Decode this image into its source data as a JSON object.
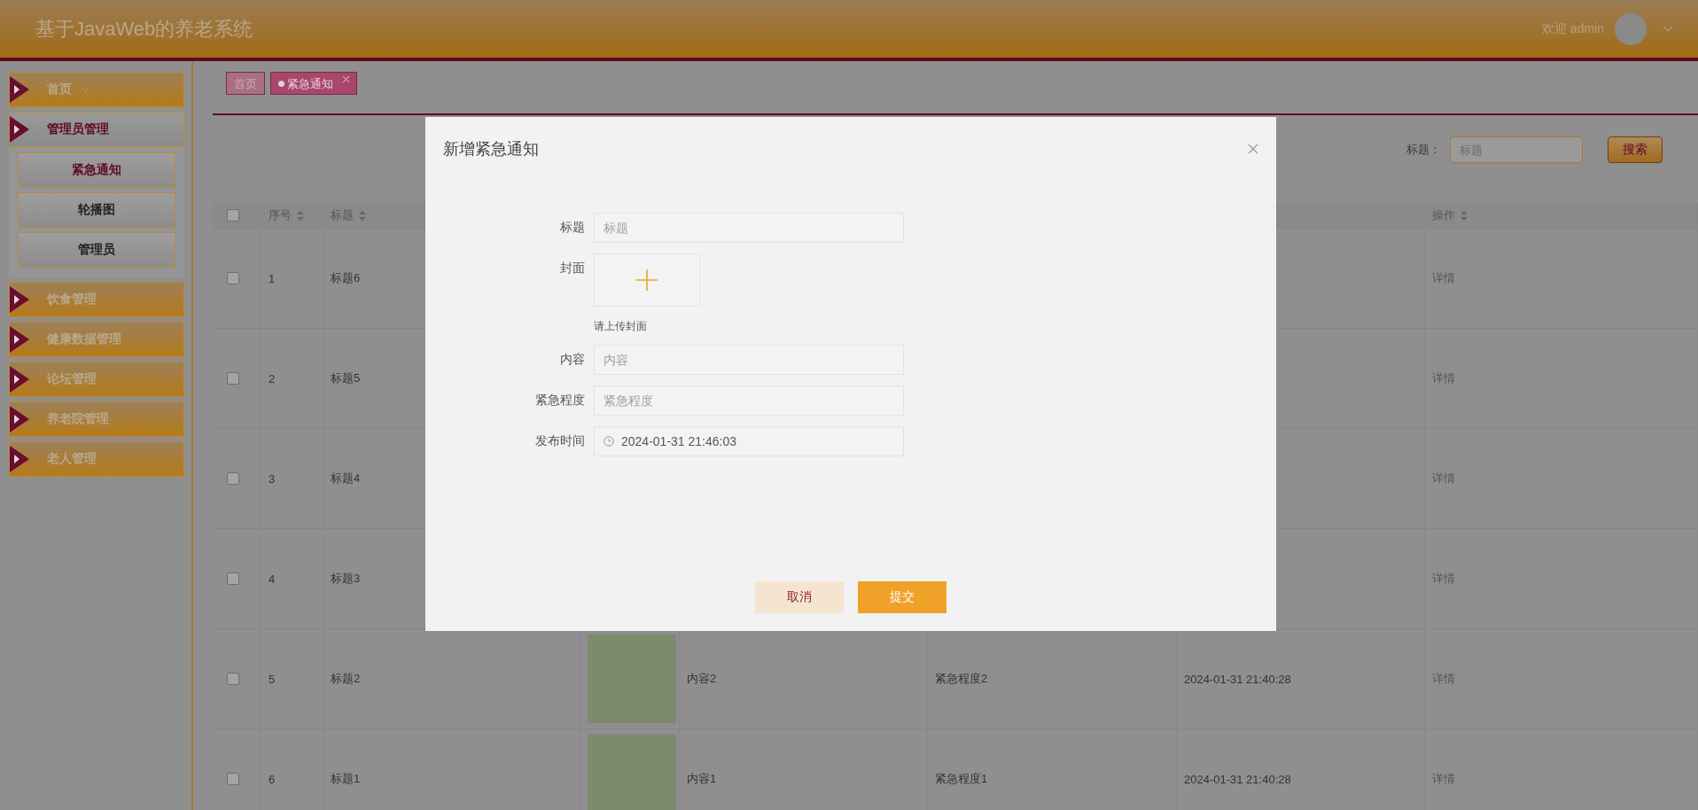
{
  "header": {
    "title": "基于JavaWeb的养老系统",
    "welcome": "欢迎 admin"
  },
  "sidebar": {
    "items": [
      {
        "label": "首页",
        "chevron": true,
        "expanded": false
      },
      {
        "label": "管理员管理",
        "chevron": false,
        "expanded": true,
        "children": [
          {
            "label": "紧急通知",
            "selected": true
          },
          {
            "label": "轮播图",
            "selected": false
          },
          {
            "label": "管理员",
            "selected": false
          }
        ]
      },
      {
        "label": "饮食管理",
        "chevron": false,
        "expanded": false
      },
      {
        "label": "健康数据管理",
        "chevron": false,
        "expanded": false
      },
      {
        "label": "论坛管理",
        "chevron": false,
        "expanded": false
      },
      {
        "label": "养老院管理",
        "chevron": false,
        "expanded": false
      },
      {
        "label": "老人管理",
        "chevron": false,
        "expanded": false
      }
    ]
  },
  "tabs": [
    {
      "label": "首页",
      "selected": false,
      "closable": false
    },
    {
      "label": "紧急通知",
      "selected": true,
      "closable": true
    }
  ],
  "search": {
    "label": "标题：",
    "placeholder": "标题",
    "button": "搜索"
  },
  "table": {
    "all_checked": false,
    "columns": [
      {
        "label": "序号"
      },
      {
        "label": "标题"
      },
      {
        "label": "操作"
      }
    ],
    "rows": [
      {
        "checked": false,
        "index": "1",
        "title": "标题6",
        "action": "详情"
      },
      {
        "checked": false,
        "index": "2",
        "title": "标题5",
        "action": "详情"
      },
      {
        "checked": false,
        "index": "3",
        "title": "标题4",
        "action": "详情"
      },
      {
        "checked": false,
        "index": "4",
        "title": "标题3",
        "action": "详情"
      },
      {
        "checked": false,
        "index": "5",
        "title": "标题2",
        "has_cover": true,
        "content": "内容2",
        "urgency": "紧急程度2",
        "time": "2024-01-31 21:40:28",
        "action": "详情"
      },
      {
        "checked": false,
        "index": "6",
        "title": "标题1",
        "has_cover": true,
        "content": "内容1",
        "urgency": "紧急程度1",
        "time": "2024-01-31 21:40:28",
        "action": "详情"
      }
    ]
  },
  "dialog": {
    "title": "新增紧急通知",
    "fields": [
      {
        "kind": "text",
        "label": "标题",
        "placeholder": "标题"
      },
      {
        "kind": "upload",
        "label": "封面",
        "hint": "请上传封面"
      },
      {
        "kind": "text",
        "label": "内容",
        "placeholder": "内容"
      },
      {
        "kind": "text",
        "label": "紧急程度",
        "placeholder": "紧急程度"
      },
      {
        "kind": "datetime",
        "label": "发布时间",
        "value": "2024-01-31 21:46:03"
      }
    ],
    "buttons": [
      {
        "label": "取消",
        "kind": "secondary"
      },
      {
        "label": "提交",
        "kind": "primary"
      }
    ]
  }
}
